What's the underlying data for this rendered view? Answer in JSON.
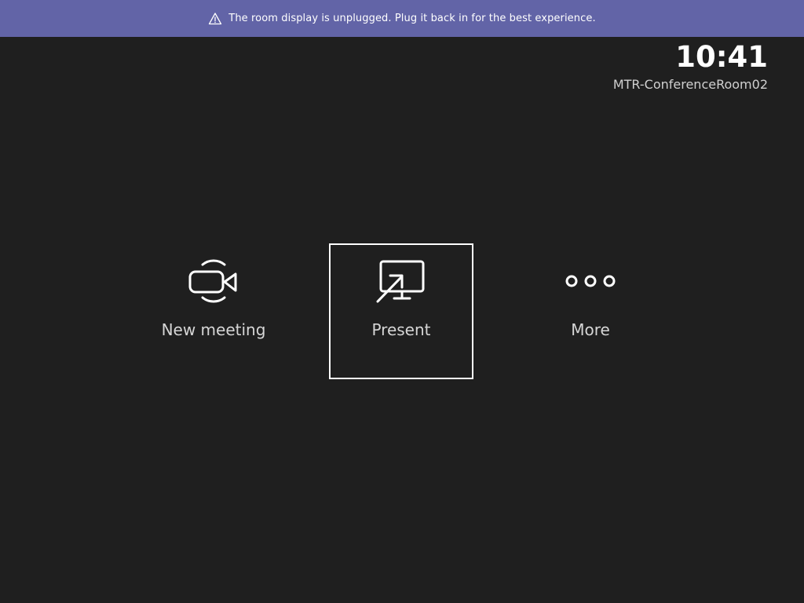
{
  "banner": {
    "icon": "warning-triangle-icon",
    "message": "The room display is unplugged. Plug it back in for the best experience.",
    "background_color": "#6264a7"
  },
  "status": {
    "time": "10:41",
    "room_name": "MTR-ConferenceRoom02"
  },
  "actions": [
    {
      "label": "New meeting",
      "icon": "video-camera-icon",
      "focused": false
    },
    {
      "label": "Present",
      "icon": "present-screen-icon",
      "focused": true
    },
    {
      "label": "More",
      "icon": "more-dots-icon",
      "focused": false
    }
  ],
  "theme": {
    "background": "#1f1f1f",
    "text": "#ffffff",
    "focus_border": "#ffffff"
  }
}
